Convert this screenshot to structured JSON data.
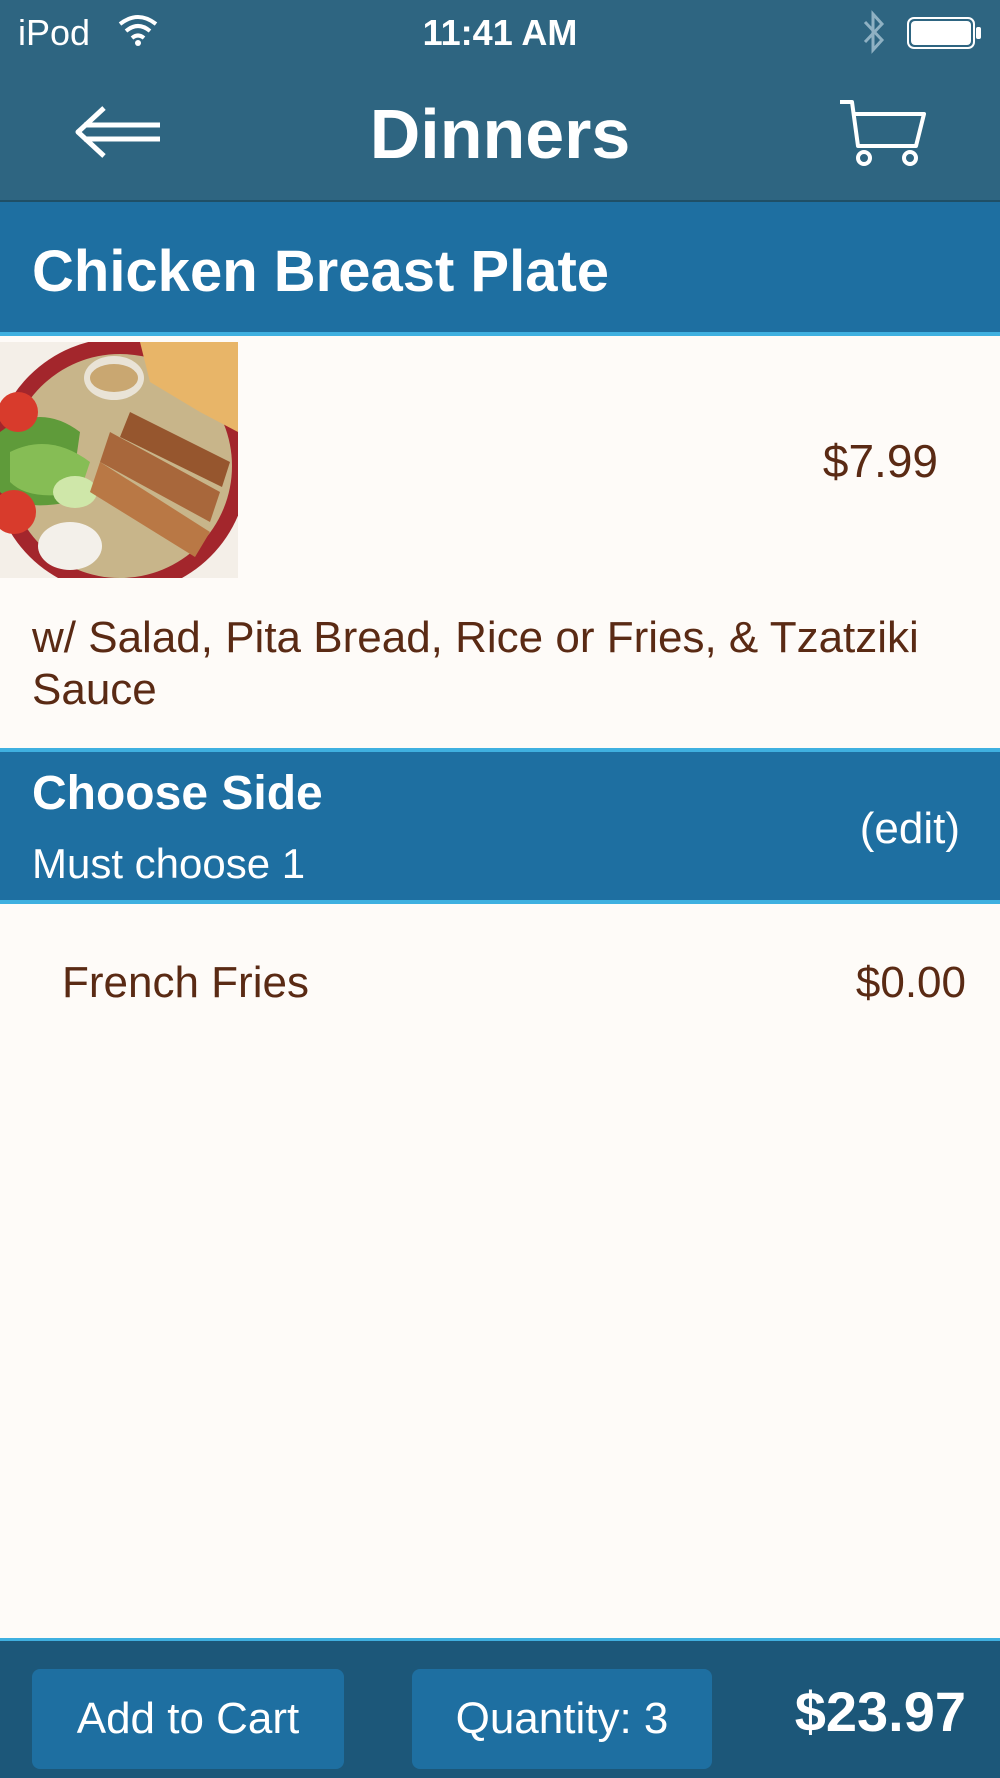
{
  "status_bar": {
    "carrier": "iPod",
    "time": "11:41 AM"
  },
  "nav": {
    "title": "Dinners",
    "back_icon": "back-arrow-icon",
    "cart_icon": "cart-icon"
  },
  "item": {
    "name": "Chicken Breast Plate",
    "price": "$7.99",
    "description": "w/ Salad, Pita Bread,  Rice or Fries, & Tzatziki Sauce"
  },
  "option_group": {
    "title": "Choose Side",
    "subtitle": "Must choose 1",
    "edit_label": "(edit)"
  },
  "selected_side": {
    "name": "French Fries",
    "price": "$0.00"
  },
  "bottom": {
    "add_label": "Add to Cart",
    "quantity_label": "Quantity: 3",
    "total": "$23.97"
  },
  "colors": {
    "nav": "#2e6581",
    "header": "#1e6fa1",
    "accent": "#3fb0e0",
    "text": "#5a2a14",
    "background": "#fefbf8"
  }
}
